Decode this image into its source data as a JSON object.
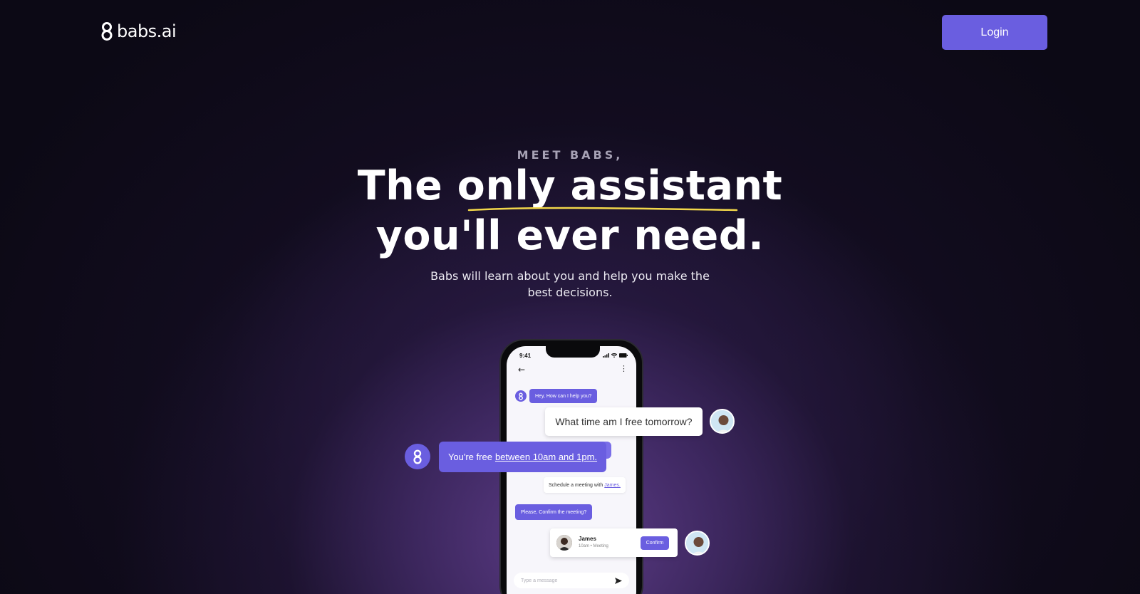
{
  "header": {
    "logo_text": "babs.ai",
    "login_label": "Login"
  },
  "hero": {
    "eyebrow": "MEET BABS,",
    "headline_prefix": "The ",
    "headline_highlight": "only assistant",
    "headline_line2": "you'll ever need.",
    "subtitle": "Babs will learn about you and help you make the best decisions."
  },
  "phone": {
    "status_time": "9:41",
    "greeting": "Hey, How can I help you?",
    "schedule_text": "Schedule a meeting with",
    "schedule_link": "James.",
    "confirm_prompt": "Please, Confirm the meeting?",
    "input_placeholder": "Type a message"
  },
  "floating": {
    "question": "What time am I free tomorrow?",
    "answer_prefix": "You're free",
    "answer_link": "between 10am and 1pm.",
    "meeting": {
      "name": "James",
      "subtitle": "10am • Meeting",
      "confirm_label": "Confirm"
    }
  },
  "colors": {
    "accent": "#6a5ee0",
    "background": "#0c0915",
    "highlight_underline": "#f2d74a"
  },
  "icons": [
    "babs-logo-icon",
    "back-arrow-icon",
    "more-icon",
    "send-icon",
    "signal-icon",
    "wifi-icon",
    "battery-icon"
  ]
}
